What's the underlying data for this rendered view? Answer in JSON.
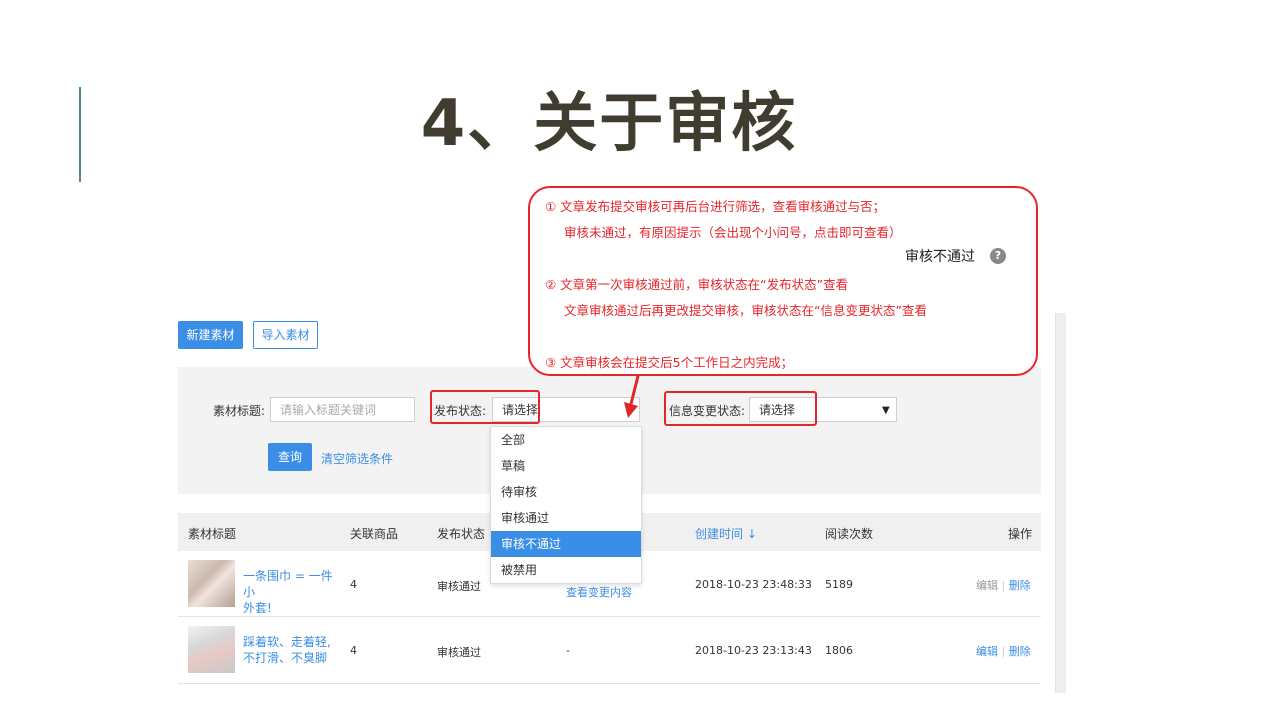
{
  "slide": {
    "title": "4、关于审核"
  },
  "toolbar": {
    "new_material": "新建素材",
    "import_material": "导入素材"
  },
  "filters": {
    "title_label": "素材标题:",
    "title_placeholder": "请输入标题关键词",
    "publish_status_label": "发布状态:",
    "publish_status_value": "请选择",
    "info_change_label": "信息变更状态:",
    "info_change_value": "请选择",
    "query_button": "查询",
    "clear_link": "清空筛选条件"
  },
  "publish_status_options": [
    "全部",
    "草稿",
    "待审核",
    "审核通过",
    "审核不通过",
    "被禁用"
  ],
  "selected_option_index": 4,
  "table": {
    "headers": [
      "素材标题",
      "关联商品",
      "发布状态",
      "创建时间 ↓",
      "阅读次数",
      "操作"
    ],
    "rows": [
      {
        "title": "一条围巾 = 一件小外套!",
        "title_line1": "一条围巾 = 一件小",
        "title_line2": "外套!",
        "products": "4",
        "status": "审核通过",
        "change": "查看变更内容",
        "created": "2018-10-23 23:48:33",
        "reads": "5189",
        "edit": "编辑",
        "sep": "|",
        "delete": "删除"
      },
      {
        "title": "踩着软、走着轻,不打滑、不臭脚",
        "title_line1": "踩着软、走着轻,",
        "title_line2": "不打滑、不臭脚",
        "products": "4",
        "status": "审核通过",
        "change": "-",
        "created": "2018-10-23 23:13:43",
        "reads": "1806",
        "edit": "编辑",
        "sep": "|",
        "delete": "删除"
      }
    ]
  },
  "annotation": {
    "line1": "① 文章发布提交审核可再后台进行筛选，查看审核通过与否；",
    "line2": "审核未通过，有原因提示（会出现个小问号，点击即可查看）",
    "tooltip_label": "审核不通过",
    "tooltip_icon": "?",
    "line3": "② 文章第一次审核通过前，审核状态在“发布状态”查看",
    "line4": "文章审核通过后再更改提交审核，审核状态在“信息变更状态”查看",
    "line5": "③ 文章审核会在提交后5个工作日之内完成；"
  },
  "colors": {
    "accent_blue": "#3b8ee6",
    "annotation_red": "#e6252a",
    "title_dark": "#403c30"
  }
}
